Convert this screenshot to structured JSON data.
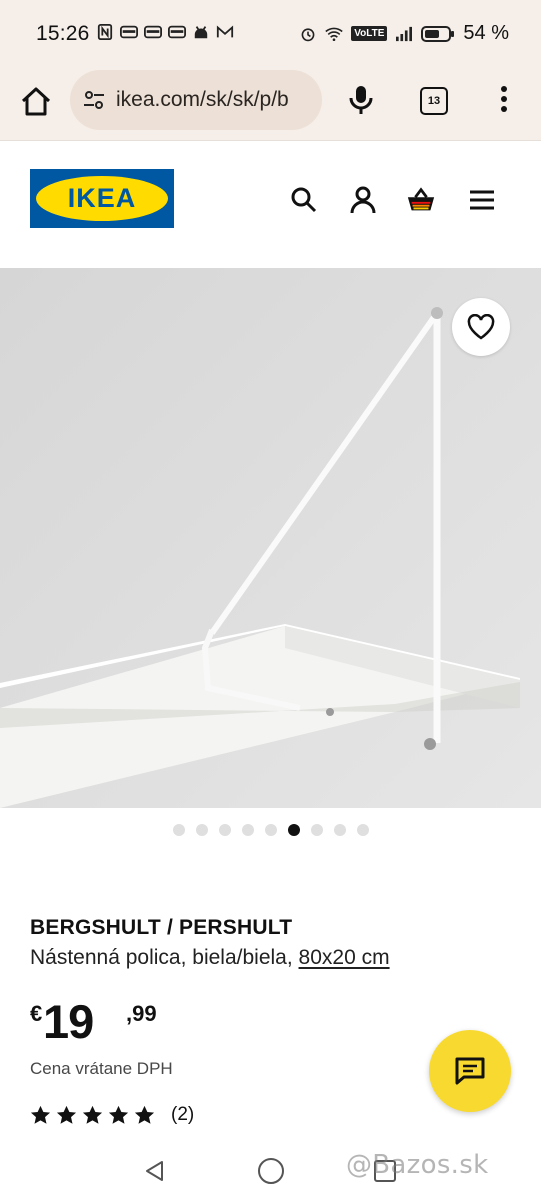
{
  "status_bar": {
    "time": "15:26",
    "battery": "54 %",
    "icons": [
      "nfc-icon",
      "notification-icon",
      "notification-icon",
      "notification-icon",
      "android-icon",
      "gmail-icon",
      "alarm-icon",
      "wifi-icon",
      "volte-icon",
      "signal-icon",
      "battery-icon"
    ],
    "volte_label": "VoLTE"
  },
  "browser": {
    "url": "ikea.com/sk/sk/p/b",
    "tab_count": "13",
    "icons": [
      "home-icon",
      "site-settings-icon",
      "microphone-icon",
      "tabs-icon",
      "more-icon"
    ]
  },
  "site_header": {
    "logo_text": "IKEA",
    "icons": [
      "search-icon",
      "account-icon",
      "cart-icon",
      "menu-icon"
    ],
    "brand_colors": {
      "blue": "#0058a3",
      "yellow": "#ffdb00"
    }
  },
  "gallery": {
    "image_count": 9,
    "active_index": 5,
    "favorite_icon": "heart-icon"
  },
  "product": {
    "name": "BERGSHULT / PERSHULT",
    "description": "Nástenná polica, biela/biela,",
    "size": "80x20 cm",
    "price_currency": "€",
    "price_integer": "19",
    "price_decimal": ",99",
    "vat_note": "Cena vrátane DPH",
    "rating": 5,
    "review_count": "(2)"
  },
  "chat": {
    "icon": "chat-icon",
    "color": "#f8d92f"
  },
  "watermark": "@Bazos.sk"
}
